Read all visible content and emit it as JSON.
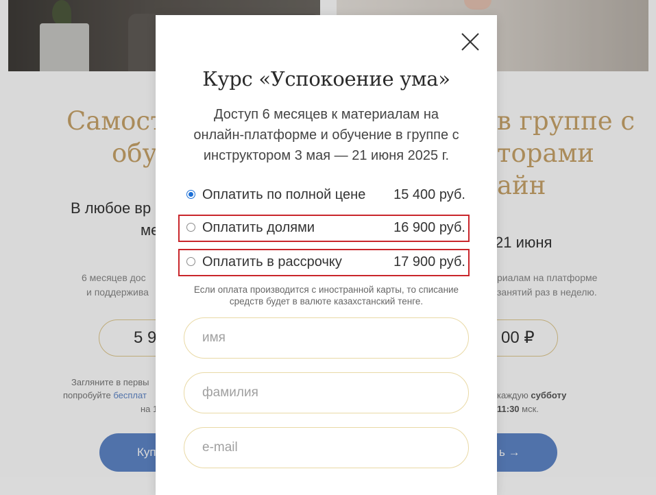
{
  "background": {
    "left_card": {
      "heading_lines": [
        "Самосто",
        "обуч"
      ],
      "subtitle_lines": [
        "В любое вр",
        "ме"
      ],
      "info_lines": [
        "6 месяцев дос",
        "и поддержива"
      ],
      "price": "5 9",
      "footnote_lines": [
        "Загляните в первы",
        "попробуйте ",
        "на 1"
      ],
      "footnote_link": "бесплат",
      "button_label": "Куп"
    },
    "right_card": {
      "heading_lines": [
        "в группе с",
        "торами",
        "айн"
      ],
      "subtitle": "21 июня",
      "info_lines": [
        "риалам на платформе",
        "занятий раз в неделю."
      ],
      "price": "00 ₽",
      "footnote_pre": "каждую ",
      "footnote_bold": "субботу",
      "footnote_time": "11:30",
      "footnote_post": " мск.",
      "button_label": "ь →"
    }
  },
  "modal": {
    "close_icon": "close-x-icon",
    "title": "Курс «Успокоение ума»",
    "description_lines": [
      "Доступ 6 месяцев к материалам на",
      "онлайн-платформе и обучение в группе с",
      "инструктором 3 мая — 21 июня 2025 г."
    ],
    "payment_options": [
      {
        "label": "Оплатить по полной цене",
        "price": "15 400 руб.",
        "selected": true,
        "highlighted": false
      },
      {
        "label": "Оплатить долями",
        "price": "16 900 руб.",
        "selected": false,
        "highlighted": true
      },
      {
        "label": "Оплатить в рассрочку",
        "price": "17 900 руб.",
        "selected": false,
        "highlighted": true
      }
    ],
    "note_lines": [
      "Если оплата производится с иностранной карты, то списание",
      "средств будет в валюте казахстанский тенге."
    ],
    "fields": {
      "name_placeholder": "имя",
      "surname_placeholder": "фамилия",
      "email_placeholder": "e-mail"
    }
  },
  "colors": {
    "accent_gold": "#c8a46a",
    "button_blue": "#5f86c8",
    "highlight_red": "#c9262b",
    "radio_blue": "#1b6fd6"
  }
}
